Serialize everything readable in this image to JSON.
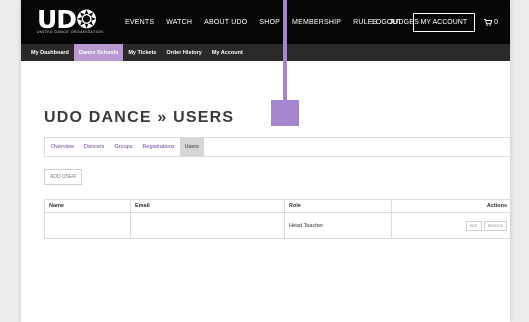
{
  "brand": {
    "name": "UD",
    "tagline": "UNITED DANCE ORGANISATION"
  },
  "main_nav": [
    "EVENTS",
    "WATCH",
    "ABOUT UDO",
    "SHOP",
    "MEMBERSHIP",
    "RULES",
    "JUDGES"
  ],
  "header_right": {
    "logout": "LOGOUT",
    "account": "MY ACCOUNT",
    "cart_count": "0"
  },
  "sub_nav": [
    {
      "label": "My Dashboard",
      "active": false
    },
    {
      "label": "Dance Schools",
      "active": true
    },
    {
      "label": "My Tickets",
      "active": false
    },
    {
      "label": "Order History",
      "active": false
    },
    {
      "label": "My Account",
      "active": false
    }
  ],
  "page_title": "UDO DANCE » USERS",
  "tabs": [
    {
      "label": "Overview",
      "active": false
    },
    {
      "label": "Dancers",
      "active": false
    },
    {
      "label": "Groups",
      "active": false
    },
    {
      "label": "Registrations",
      "active": false
    },
    {
      "label": "Users",
      "active": true
    }
  ],
  "add_user_label": "ADD USER",
  "table": {
    "headers": [
      "Name",
      "Email",
      "Role",
      "Actions"
    ],
    "rows": [
      {
        "name": "",
        "email": "",
        "role": "Head Teacher",
        "edit": "EDIT",
        "remove": "REMOVE"
      }
    ]
  },
  "colors": {
    "accent": "#b79bd0",
    "marker": "#a486cd",
    "header_bg": "#070707",
    "subnav_bg": "#2a2a2a",
    "link": "#6a3fa0"
  }
}
